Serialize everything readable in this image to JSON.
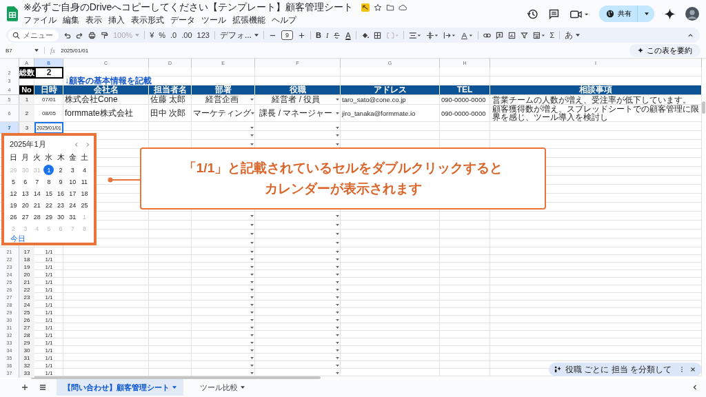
{
  "window": {
    "title": "※必ずご自身のDriveへコピーしてください【テンプレート】顧客管理シート"
  },
  "menu": [
    "ファイル",
    "編集",
    "表示",
    "挿入",
    "表示形式",
    "データ",
    "ツール",
    "拡張機能",
    "ヘルプ"
  ],
  "share_button": "共有",
  "toolbar": {
    "search": "メニュー",
    "zoom": "100%",
    "currency": "¥",
    "percent": "%",
    "decrease_decimal": ".0",
    "increase_decimal": ".00",
    "number_format": "123",
    "font": "デフォ...",
    "font_size": "9",
    "bold": "B",
    "italic": "I",
    "text_color": "A",
    "sum": "Σ",
    "input_tool": "あ"
  },
  "formula_bar": {
    "cell_ref": "B7",
    "fx": "fx",
    "value": "2025/01/01"
  },
  "summarize_button": "この表を要約",
  "columns": [
    "A",
    "B",
    "C",
    "D",
    "E",
    "F",
    "G",
    "H",
    "I"
  ],
  "total": {
    "row": "2",
    "label": "総数",
    "value": "2"
  },
  "note": {
    "row": "3",
    "text": "↓顧客の基本情報を記載"
  },
  "table_headers": {
    "row": "4",
    "labels": [
      "No",
      "日時",
      "会社名",
      "担当者名",
      "部署",
      "役職",
      "アドレス",
      "TEL",
      "相談事項"
    ]
  },
  "rows": [
    {
      "row": "5",
      "no": "1",
      "date": "07/01",
      "company": "株式会社Cone",
      "person": "佐藤 太郎",
      "department": "経営企画",
      "position": "経営者 / 役員",
      "email": "taro_sato@cone.co.jp",
      "tel": "090-0000-0000",
      "consultation": "営業チームの人数が増え、受注率が低下しています。",
      "selected": false
    },
    {
      "row": "6",
      "no": "2",
      "date": "08/05",
      "company": "formmate株式会社",
      "person": "田中 次郎",
      "department": "マーケティング",
      "position": "課長 / マネージャー",
      "email": "jiro_tanaka@formmate.io",
      "tel": "090-0000-0000",
      "consultation": "顧客獲得数が増え、スプレッドシートでの顧客管理に限界を感じ、ツール導入を検討し",
      "selected": false
    },
    {
      "row": "7",
      "no": "3",
      "date": "2025/01/01",
      "selected": true
    }
  ],
  "rows_below_calendar": [
    {
      "row": "21",
      "no": "17",
      "date": "1/1",
      "selected": false
    },
    {
      "row": "22",
      "no": "18",
      "date": "1/1",
      "selected": false
    },
    {
      "row": "23",
      "no": "19",
      "date": "1/1",
      "selected": false
    },
    {
      "row": "24",
      "no": "20",
      "date": "1/1",
      "selected": false
    },
    {
      "row": "25",
      "no": "21",
      "date": "1/1",
      "selected": false
    },
    {
      "row": "26",
      "no": "22",
      "date": "1/1",
      "selected": false
    },
    {
      "row": "27",
      "no": "23",
      "date": "1/1",
      "selected": false
    },
    {
      "row": "28",
      "no": "24",
      "date": "1/1",
      "selected": false
    },
    {
      "row": "29",
      "no": "25",
      "date": "1/1",
      "selected": false
    },
    {
      "row": "30",
      "no": "26",
      "date": "1/1",
      "selected": false
    },
    {
      "row": "31",
      "no": "27",
      "date": "1/1",
      "selected": false
    },
    {
      "row": "32",
      "no": "28",
      "date": "1/1",
      "selected": false
    },
    {
      "row": "33",
      "no": "29",
      "date": "1/1",
      "selected": false
    },
    {
      "row": "34",
      "no": "30",
      "date": "1/1",
      "selected": false
    },
    {
      "row": "35",
      "no": "31",
      "date": "1/1",
      "selected": false
    },
    {
      "row": "36",
      "no": "32",
      "date": "1/1",
      "selected": false
    },
    {
      "row": "37",
      "no": "33",
      "date": "1/1",
      "selected": false
    }
  ],
  "calendar": {
    "month": "2025年1月",
    "weekdays": [
      "日",
      "月",
      "火",
      "水",
      "木",
      "金",
      "土"
    ],
    "days": [
      {
        "label": "29",
        "muted": true,
        "selected": false
      },
      {
        "label": "30",
        "muted": true,
        "selected": false
      },
      {
        "label": "31",
        "muted": true,
        "selected": false
      },
      {
        "label": "1",
        "muted": false,
        "selected": true
      },
      {
        "label": "2",
        "muted": false,
        "selected": false
      },
      {
        "label": "3",
        "muted": false,
        "selected": false
      },
      {
        "label": "4",
        "muted": false,
        "selected": false
      },
      {
        "label": "5",
        "muted": false,
        "selected": false
      },
      {
        "label": "6",
        "muted": false,
        "selected": false
      },
      {
        "label": "7",
        "muted": false,
        "selected": false
      },
      {
        "label": "8",
        "muted": false,
        "selected": false
      },
      {
        "label": "9",
        "muted": false,
        "selected": false
      },
      {
        "label": "10",
        "muted": false,
        "selected": false
      },
      {
        "label": "11",
        "muted": false,
        "selected": false
      },
      {
        "label": "12",
        "muted": false,
        "selected": false
      },
      {
        "label": "13",
        "muted": false,
        "selected": false
      },
      {
        "label": "14",
        "muted": false,
        "selected": false
      },
      {
        "label": "15",
        "muted": false,
        "selected": false
      },
      {
        "label": "16",
        "muted": false,
        "selected": false
      },
      {
        "label": "17",
        "muted": false,
        "selected": false
      },
      {
        "label": "18",
        "muted": false,
        "selected": false
      },
      {
        "label": "19",
        "muted": false,
        "selected": false
      },
      {
        "label": "20",
        "muted": false,
        "selected": false
      },
      {
        "label": "21",
        "muted": false,
        "selected": false
      },
      {
        "label": "22",
        "muted": false,
        "selected": false
      },
      {
        "label": "23",
        "muted": false,
        "selected": false
      },
      {
        "label": "24",
        "muted": false,
        "selected": false
      },
      {
        "label": "25",
        "muted": false,
        "selected": false
      },
      {
        "label": "26",
        "muted": false,
        "selected": false
      },
      {
        "label": "27",
        "muted": false,
        "selected": false
      },
      {
        "label": "28",
        "muted": false,
        "selected": false
      },
      {
        "label": "29",
        "muted": false,
        "selected": false
      },
      {
        "label": "30",
        "muted": false,
        "selected": false
      },
      {
        "label": "31",
        "muted": false,
        "selected": false
      },
      {
        "label": "1",
        "muted": true,
        "selected": false
      },
      {
        "label": "2",
        "muted": true,
        "selected": false
      },
      {
        "label": "3",
        "muted": true,
        "selected": false
      },
      {
        "label": "4",
        "muted": true,
        "selected": false
      },
      {
        "label": "5",
        "muted": true,
        "selected": false
      },
      {
        "label": "6",
        "muted": true,
        "selected": false
      },
      {
        "label": "7",
        "muted": true,
        "selected": false
      },
      {
        "label": "8",
        "muted": true,
        "selected": false
      }
    ],
    "today": "今日"
  },
  "callout": {
    "lines": [
      "「1/1」と記載されているセルをダブルクリックすると",
      "カレンダーが表示されます"
    ]
  },
  "sheet_tabs": [
    {
      "label": "【問い合わせ】顧客管理シート",
      "selected": true
    },
    {
      "label": "ツール比較",
      "selected": false
    }
  ],
  "suggestion_chip": {
    "text": "役職 ごとに 担当 を分類して"
  }
}
